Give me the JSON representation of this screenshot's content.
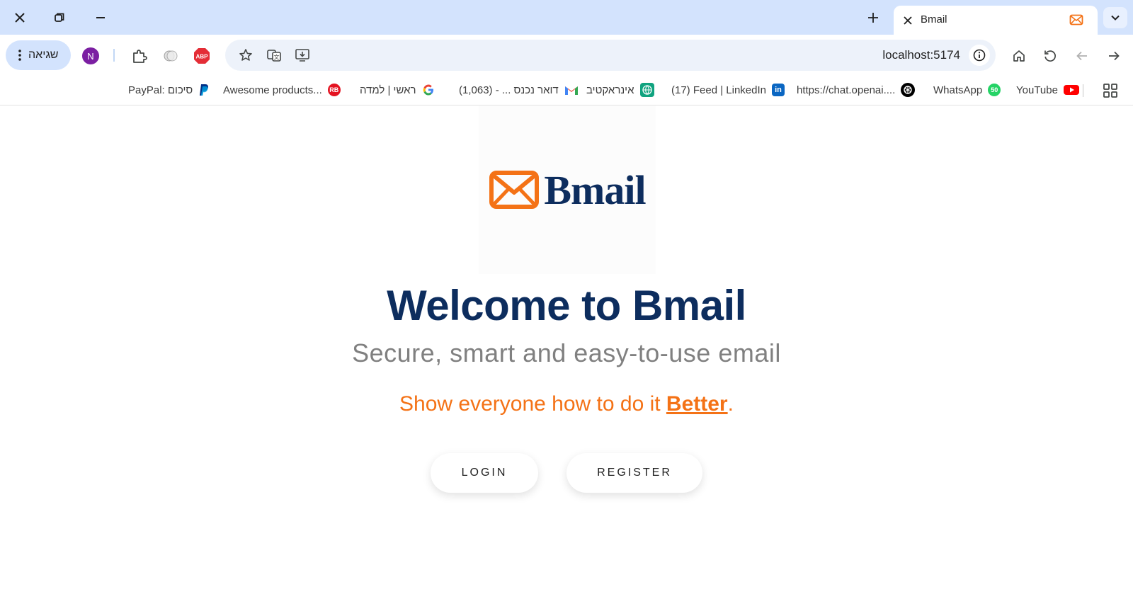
{
  "browser": {
    "tab": {
      "title": "Bmail"
    },
    "address": {
      "url": "localhost:5174"
    },
    "error_chip": {
      "label": "שגיאה"
    },
    "profile": {
      "initial": "N"
    },
    "extension_abp": {
      "label": "ABP"
    },
    "bookmarks": [
      {
        "label": "YouTube",
        "icon": "youtube-icon",
        "color": "#ff0000"
      },
      {
        "label": "WhatsApp",
        "icon": "whatsapp-icon",
        "badge": "50",
        "color": "#25d366"
      },
      {
        "label": "https://chat.openai....",
        "icon": "openai-icon",
        "color": "#000000"
      },
      {
        "label": "(17) Feed | LinkedIn",
        "icon": "linkedin-icon",
        "color": "#0a66c2"
      },
      {
        "label": "אינראקטיב",
        "icon": "globe-icon",
        "color": "#10a37f"
      },
      {
        "label": "דואר נכנס ... - (1,063)",
        "icon": "gmail-icon",
        "color": "#ea4335"
      },
      {
        "label": "ראשי | למדה",
        "icon": "google-icon",
        "color": "#4285f4"
      },
      {
        "label": "Awesome products...",
        "icon": "redbubble-icon",
        "color": "#e41321"
      },
      {
        "label": "PayPal: סיכום",
        "icon": "paypal-icon",
        "color": "#003087"
      }
    ]
  },
  "page": {
    "logo_text": "Bmail",
    "welcome": "Welcome to Bmail",
    "subtitle": "Secure, smart and easy-to-use email",
    "tagline_prefix": "Show everyone how to do it ",
    "tagline_emphasis": "Better",
    "tagline_suffix": ".",
    "login_label": "LOGIN",
    "register_label": "REGISTER",
    "brand_orange": "#f47216",
    "brand_navy": "#0d2d5e"
  }
}
